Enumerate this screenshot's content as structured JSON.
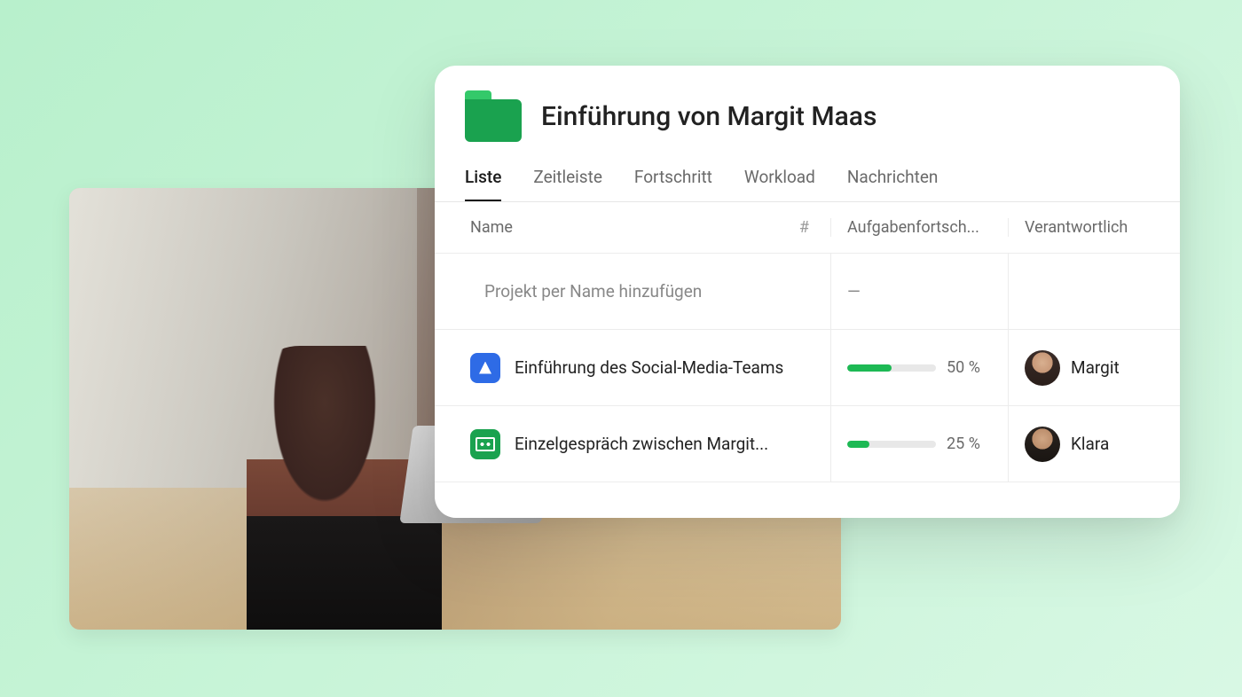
{
  "header": {
    "title": "Einführung von Margit Maas"
  },
  "tabs": [
    {
      "label": "Liste",
      "active": true
    },
    {
      "label": "Zeitleiste",
      "active": false
    },
    {
      "label": "Fortschritt",
      "active": false
    },
    {
      "label": "Workload",
      "active": false
    },
    {
      "label": "Nachrichten",
      "active": false
    }
  ],
  "columns": {
    "name": "Name",
    "progress": "Aufgabenfortsch...",
    "owner": "Verantwortlich"
  },
  "placeholder_row": {
    "text": "Projekt per Name hinzufügen",
    "progress_placeholder": "—"
  },
  "rows": [
    {
      "icon": "blue",
      "name": "Einführung des Social-Media-Teams",
      "progress_pct": 50,
      "progress_label": "50 %",
      "owner": "Margit"
    },
    {
      "icon": "green",
      "name": "Einzelgespräch zwischen Margit...",
      "progress_pct": 25,
      "progress_label": "25 %",
      "owner": "Klara"
    }
  ]
}
